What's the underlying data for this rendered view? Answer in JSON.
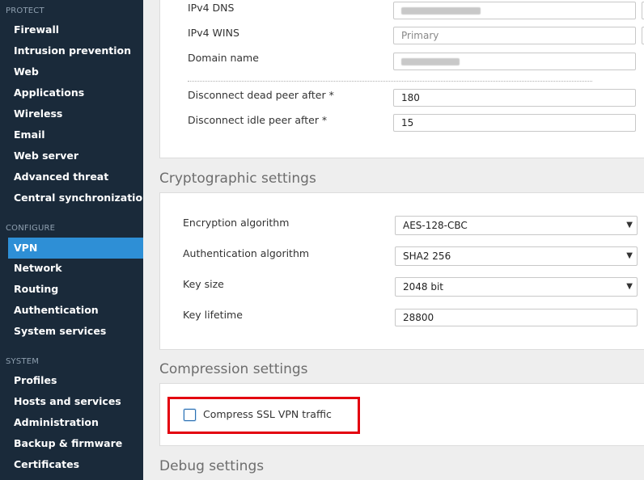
{
  "sidebar": {
    "sections": [
      {
        "title": "PROTECT",
        "items": [
          "Firewall",
          "Intrusion prevention",
          "Web",
          "Applications",
          "Wireless",
          "Email",
          "Web server",
          "Advanced threat",
          "Central synchronization"
        ]
      },
      {
        "title": "CONFIGURE",
        "items": [
          "VPN",
          "Network",
          "Routing",
          "Authentication",
          "System services"
        ]
      },
      {
        "title": "SYSTEM",
        "items": [
          "Profiles",
          "Hosts and services",
          "Administration",
          "Backup & firmware",
          "Certificates"
        ]
      }
    ],
    "active_item": "VPN"
  },
  "network_settings": {
    "ipv4_dns_label": "IPv4 DNS",
    "ipv4_wins_label": "IPv4 WINS",
    "ipv4_wins_placeholder": "Primary",
    "domain_name_label": "Domain name",
    "dead_peer_label": "Disconnect dead peer after *",
    "dead_peer_value": "180",
    "idle_peer_label": "Disconnect idle peer after *",
    "idle_peer_value": "15"
  },
  "crypto": {
    "title": "Cryptographic settings",
    "encryption_label": "Encryption algorithm",
    "encryption_value": "AES-128-CBC",
    "auth_label": "Authentication algorithm",
    "auth_value": "SHA2 256",
    "key_size_label": "Key size",
    "key_size_value": "2048 bit",
    "key_lifetime_label": "Key lifetime",
    "key_lifetime_value": "28800"
  },
  "compression": {
    "title": "Compression settings",
    "checkbox_label": "Compress SSL VPN traffic",
    "checked": false
  },
  "debug": {
    "title": "Debug settings"
  },
  "icons": {
    "dropdown": "chevron-down-icon"
  },
  "colors": {
    "sidebar_bg": "#1a2a3a",
    "active": "#2e8fd6",
    "highlight": "#e3000f"
  }
}
